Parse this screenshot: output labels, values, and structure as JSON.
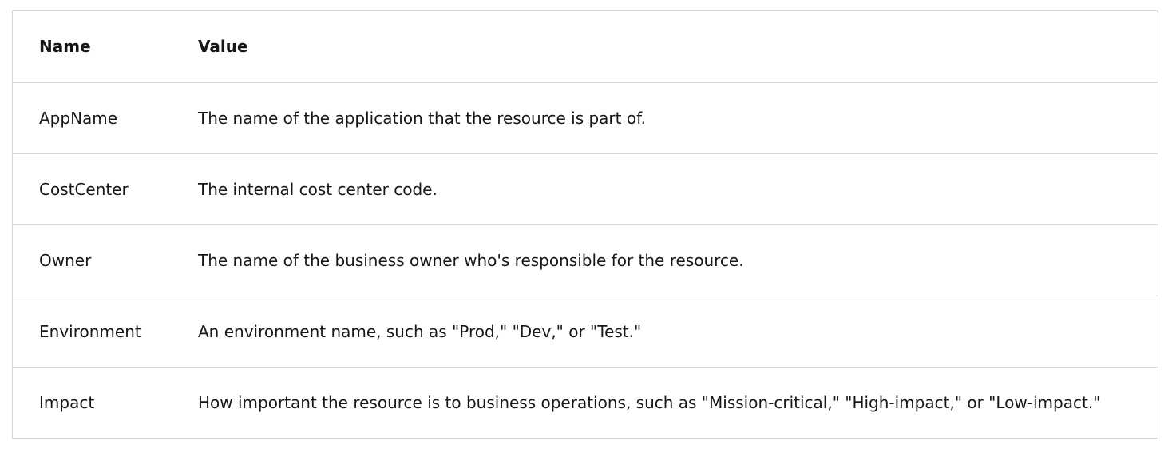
{
  "table": {
    "headers": {
      "name": "Name",
      "value": "Value"
    },
    "rows": [
      {
        "name": "AppName",
        "value": "The name of the application that the resource is part of."
      },
      {
        "name": "CostCenter",
        "value": "The internal cost center code."
      },
      {
        "name": "Owner",
        "value": "The name of the business owner who's responsible for the resource."
      },
      {
        "name": "Environment",
        "value": "An environment name, such as \"Prod,\" \"Dev,\" or \"Test.\""
      },
      {
        "name": "Impact",
        "value": "How important the resource is to business operations, such as \"Mission-critical,\" \"High-impact,\" or \"Low-impact.\""
      }
    ]
  }
}
